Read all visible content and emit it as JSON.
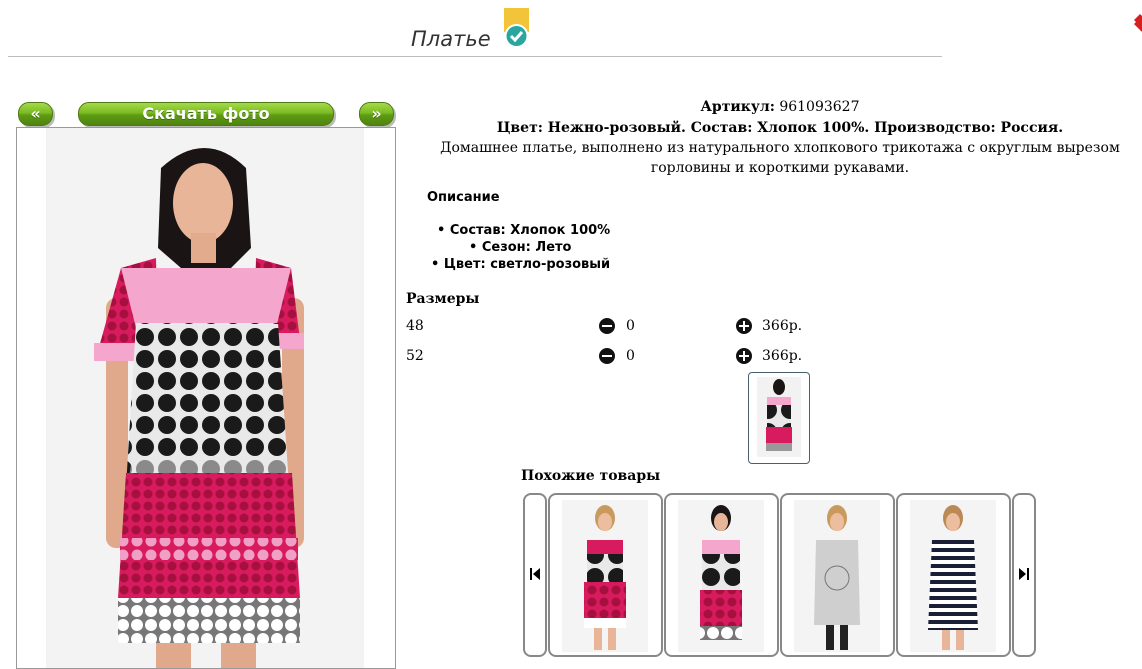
{
  "header": {
    "title": "Платье"
  },
  "gallery": {
    "prev_label": "«",
    "download_label": "Скачать фото",
    "next_label": "»"
  },
  "product": {
    "article_label": "Артикул:",
    "article_value": "961093627",
    "color_line": "Цвет: Нежно-розовый. Состав: Хлопок 100%. Производство: Россия.",
    "description": "Домашнее платье, выполнено из натурального хлопкового трикотажа с округлым вырезом горловины и короткими рукавами.",
    "desc_heading": "Описание",
    "properties": [
      "Состав: Хлопок 100%",
      "Сезон: Лето",
      "Цвет: светло-розовый"
    ]
  },
  "sizes": {
    "heading": "Размеры",
    "rows": [
      {
        "size": "48",
        "qty": "0",
        "price": "366р."
      },
      {
        "size": "52",
        "qty": "0",
        "price": "366р."
      }
    ]
  },
  "similar": {
    "heading": "Похожие товары"
  },
  "colors": {
    "accent_green": "#6aa51b",
    "badge_yellow": "#f2c43a",
    "badge_teal": "#2aa6a0",
    "close_red": "#d81e1e"
  }
}
